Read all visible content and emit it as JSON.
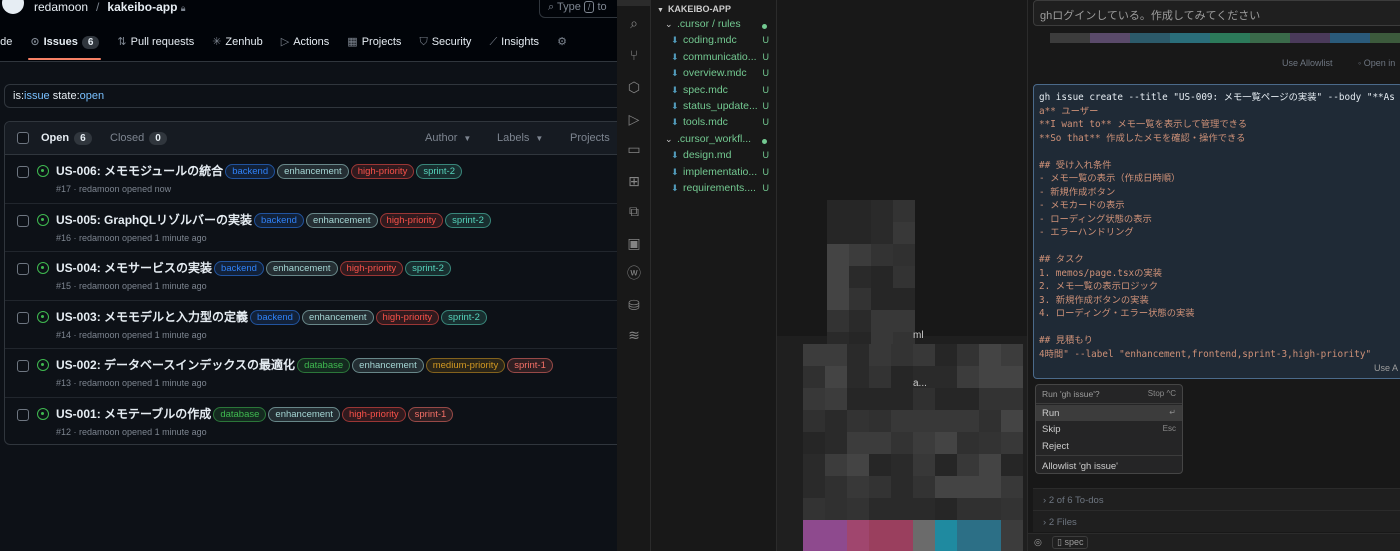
{
  "github": {
    "owner": "redamoon",
    "repo": "kakeibo-app",
    "search_label": "Type",
    "search_key": "/",
    "search_suffix": "to",
    "tabs": [
      {
        "label": "ode",
        "icon": ""
      },
      {
        "label": "Issues",
        "icon": "⊙",
        "count": "6"
      },
      {
        "label": "Pull requests",
        "icon": "⇅"
      },
      {
        "label": "Zenhub",
        "icon": "✳"
      },
      {
        "label": "Actions",
        "icon": "▷"
      },
      {
        "label": "Projects",
        "icon": "▦"
      },
      {
        "label": "Security",
        "icon": "⛉"
      },
      {
        "label": "Insights",
        "icon": "⟋"
      }
    ],
    "filter": {
      "prefix": "is:",
      "q1": "issue",
      "mid": " state:",
      "q2": "open"
    },
    "list": {
      "open_label": "Open",
      "open_count": "6",
      "closed_label": "Closed",
      "closed_count": "0",
      "author": "Author",
      "labels": "Labels",
      "projects": "Projects"
    },
    "issues": [
      {
        "title": "US-006: メモモジュールの統合",
        "meta": "#17 · redamoon opened now",
        "labels": [
          "backend",
          "enhancement",
          "high-priority",
          "sprint-2"
        ]
      },
      {
        "title": "US-005: GraphQLリゾルバーの実装",
        "meta": "#16 · redamoon opened 1 minute ago",
        "labels": [
          "backend",
          "enhancement",
          "high-priority",
          "sprint-2"
        ]
      },
      {
        "title": "US-004: メモサービスの実装",
        "meta": "#15 · redamoon opened 1 minute ago",
        "labels": [
          "backend",
          "enhancement",
          "high-priority",
          "sprint-2"
        ]
      },
      {
        "title": "US-003: メモモデルと入力型の定義",
        "meta": "#14 · redamoon opened 1 minute ago",
        "labels": [
          "backend",
          "enhancement",
          "high-priority",
          "sprint-2"
        ]
      },
      {
        "title": "US-002: データベースインデックスの最適化",
        "meta": "#13 · redamoon opened 1 minute ago",
        "labels": [
          "database",
          "enhancement",
          "medium-priority",
          "sprint-1"
        ]
      },
      {
        "title": "US-001: メモテーブルの作成",
        "meta": "#12 · redamoon opened 1 minute ago",
        "labels": [
          "database",
          "enhancement",
          "high-priority",
          "sprint-1"
        ]
      }
    ],
    "label_colors": {
      "backend": "#2f81f7",
      "database": "#3fb950",
      "enhancement": "#a5d6d4",
      "high-priority": "#f85149",
      "medium-priority": "#d29922",
      "sprint-1": "#f47067",
      "sprint-2": "#56d4bc"
    }
  },
  "vscode": {
    "explorer_title": "KAKEIBO-APP",
    "tree": [
      {
        "name": ".cursor / rules",
        "type": "folder",
        "depth": 1,
        "mark": "dot"
      },
      {
        "name": "coding.mdc",
        "type": "file",
        "depth": 2,
        "mark": "U"
      },
      {
        "name": "communicatio...",
        "type": "file",
        "depth": 2,
        "mark": "U"
      },
      {
        "name": "overview.mdc",
        "type": "file",
        "depth": 2,
        "mark": "U"
      },
      {
        "name": "spec.mdc",
        "type": "file",
        "depth": 2,
        "mark": "U"
      },
      {
        "name": "status_update...",
        "type": "file",
        "depth": 2,
        "mark": "U"
      },
      {
        "name": "tools.mdc",
        "type": "file",
        "depth": 2,
        "mark": "U"
      },
      {
        "name": ".cursor_workfl...",
        "type": "folder",
        "depth": 1,
        "mark": "dot"
      },
      {
        "name": "design.md",
        "type": "file",
        "depth": 2,
        "mark": "U"
      },
      {
        "name": "implementatio...",
        "type": "file",
        "depth": 2,
        "mark": "U"
      },
      {
        "name": "requirements....",
        "type": "file",
        "depth": 2,
        "mark": "U"
      }
    ],
    "editor_fragments": {
      "ml": "ml",
      "a": "a..."
    }
  },
  "chat": {
    "prompt": "ghログインしている。作成してみてください",
    "allowlist_top": "Use Allowlist",
    "open_in": "Open in",
    "command_lines": [
      "gh issue create --title \"US-009: メモ一覧ページの実装\" --body \"**As",
      "a** ユーザー",
      "**I want to** メモ一覧を表示して管理できる",
      "**So that** 作成したメモを確認・操作できる",
      "",
      "## 受け入れ条件",
      "- メモ一覧の表示（作成日時順）",
      "- 新規作成ボタン",
      "- メモカードの表示",
      "- ローディング状態の表示",
      "- エラーハンドリング",
      "",
      "## タスク",
      "1. memos/page.tsxの実装",
      "2. メモ一覧の表示ロジック",
      "3. 新規作成ボタンの実装",
      "4. ローディング・エラー状態の実装",
      "",
      "## 見積もり",
      "4時間\" --label \"enhancement,frontend,sprint-3,high-priority\""
    ],
    "use_allowlist_bottom": "Use A",
    "popup": {
      "question": "Run 'gh issue'?",
      "stop": "Stop ^C",
      "run": "Run",
      "run_key": "↵",
      "skip": "Skip",
      "skip_key": "Esc",
      "reject": "Reject",
      "allowlist": "Allowlist 'gh issue'"
    },
    "todos": "2 of 6 To-dos",
    "files": "2 Files",
    "spec_label": "spec"
  }
}
